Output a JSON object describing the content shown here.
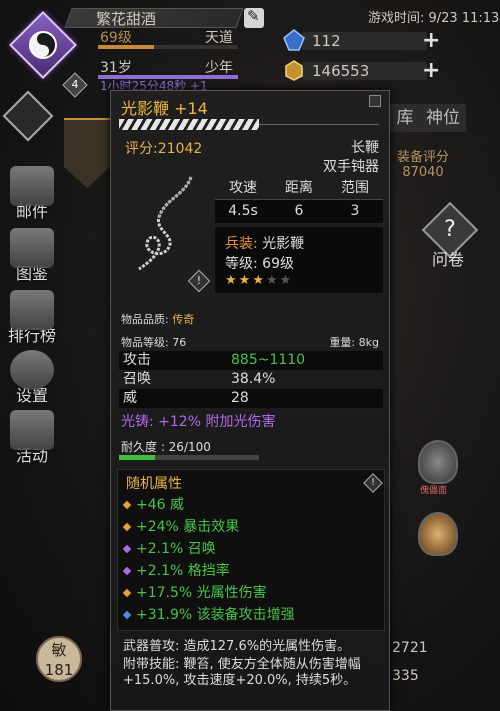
{
  "player": {
    "name": "繁花甜酒",
    "level": "69级",
    "sect": "天道",
    "age": "31岁",
    "age_stage": "少年",
    "timer": "1小时25分48秒 +1",
    "level_badge": "4"
  },
  "header": {
    "game_time": "游戏时间: 9/23 11:13",
    "resources": [
      {
        "icon": "blue-gem-icon",
        "value": "112"
      },
      {
        "icon": "gold-ore-icon",
        "value": "146553"
      }
    ]
  },
  "nav": {
    "items": [
      {
        "label": "邮件",
        "icon": "mail-icon"
      },
      {
        "label": "图鉴",
        "icon": "book-icon"
      },
      {
        "label": "排行榜",
        "icon": "ranking-icon"
      },
      {
        "label": "设置",
        "icon": "gear-icon"
      },
      {
        "label": "活动",
        "icon": "event-icon"
      }
    ]
  },
  "right": {
    "tabs": [
      "库",
      "神位"
    ],
    "score_label": "装备评分",
    "score_value": "87040",
    "help_label": "问卷",
    "mask_label": "傀儡面"
  },
  "bottom": {
    "stat_label": "敏",
    "stat_value": "181",
    "right_vals": [
      "2721",
      "335"
    ]
  },
  "item": {
    "name": "光影鞭 +14",
    "score": "评分:21042",
    "type_main": "长鞭",
    "type_sub": "双手钝器",
    "spec_headers": [
      "攻速",
      "距离",
      "范围"
    ],
    "spec_values": [
      "4.5s",
      "6",
      "3"
    ],
    "weapon_key": "兵装:",
    "weapon_name": "光影鞭",
    "weapon_level": "等级: 69级",
    "stars_total": 5,
    "stars_filled": 3,
    "quality_label": "物品品质:",
    "quality_value": "传奇",
    "item_level": "物品等级: 76",
    "weight": "重量: 8kg",
    "attributes": [
      {
        "key": "攻击",
        "value": "885~1110",
        "color": "#47c447"
      },
      {
        "key": "召唤",
        "value": "38.4%",
        "color": "#dddddd"
      },
      {
        "key": "威",
        "value": "28",
        "color": "#dddddd"
      }
    ],
    "forge": "光铸: +12% 附加光伤害",
    "durability_label": "耐久度 : 26/100",
    "durability_fraction": 0.26,
    "random_title": "随机属性",
    "random_attrs": [
      {
        "text": "+46 威",
        "dot": "#e8a03a"
      },
      {
        "text": "+24% 暴击效果",
        "dot": "#e8a03a"
      },
      {
        "text": "+2.1% 召唤",
        "dot": "#b26ae8"
      },
      {
        "text": "+2.1% 格挡率",
        "dot": "#b26ae8"
      },
      {
        "text": "+17.5% 光属性伤害",
        "dot": "#e8a03a"
      },
      {
        "text": "+31.9% 该装备攻击增强",
        "dot": "#5a8ae8"
      }
    ],
    "desc_lines": [
      "武器普攻: 造成127.6%的光属性伤害。",
      "附带技能: 鞭笞, 使友方全体随从伤害增幅+15.0%, 攻击速度+20.0%, 持续5秒。"
    ]
  }
}
